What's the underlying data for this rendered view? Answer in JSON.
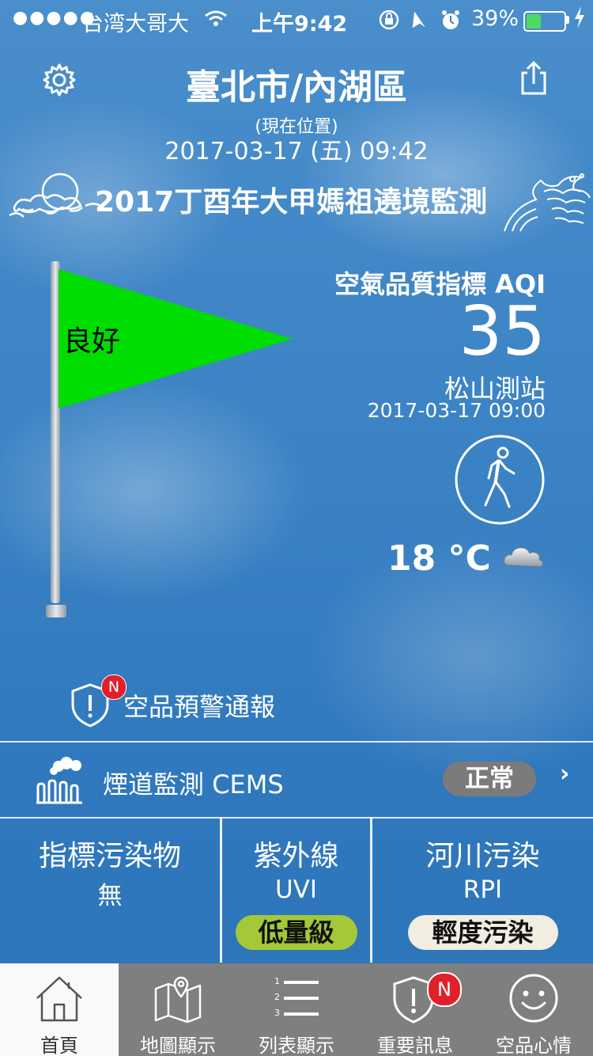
{
  "status_bar": {
    "signal": "●●●●●",
    "carrier": "台湾大哥大",
    "time": "上午9:42",
    "battery": "39%"
  },
  "header": {
    "title": "臺北市/內湖區",
    "location_note": "(現在位置)",
    "datetime": "2017-03-17 (五) 09:42",
    "banner": "2017丁酉年大甲媽祖遶境監測"
  },
  "flag": {
    "label": "良好",
    "color": "#00dd00"
  },
  "aqi": {
    "title": "空氣品質指標 AQI",
    "value": "35",
    "station": "松山測站",
    "time": "2017-03-17 09:00",
    "activity_icon": "walking-person-icon"
  },
  "weather": {
    "temperature": "18 °C",
    "icon": "cloudy-icon"
  },
  "warning": {
    "label": "空品預警通報",
    "badge": "N"
  },
  "cems": {
    "label": "煙道監測 CEMS",
    "status": "正常"
  },
  "panels": [
    {
      "title": "指標污染物",
      "sub": "無"
    },
    {
      "title": "紫外線",
      "sub": "UVI",
      "pill": "低量級",
      "pill_color": "#a4c838"
    },
    {
      "title": "河川污染",
      "sub": "RPI",
      "pill": "輕度污染",
      "pill_color": "#f1ede0"
    }
  ],
  "tabs": [
    {
      "label": "首頁",
      "icon": "home-icon"
    },
    {
      "label": "地圖顯示",
      "icon": "map-icon"
    },
    {
      "label": "列表顯示",
      "icon": "list-icon"
    },
    {
      "label": "重要訊息",
      "icon": "alert-shield-icon",
      "badge": "N"
    },
    {
      "label": "空品心情",
      "icon": "smiley-icon"
    }
  ]
}
